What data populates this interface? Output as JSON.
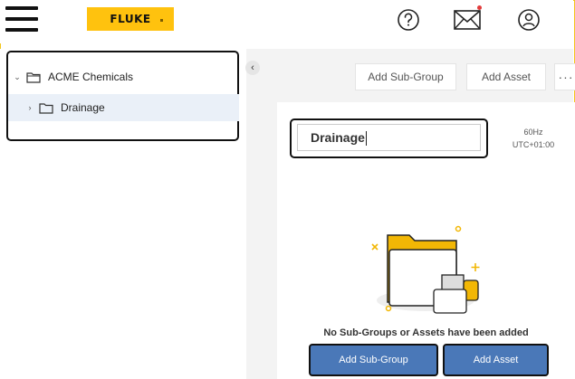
{
  "header": {
    "logo_text": "FLUKE",
    "icons": [
      "menu-icon",
      "help-icon",
      "mail-icon",
      "user-icon"
    ]
  },
  "tree": {
    "items": [
      {
        "label": "ACME Chemicals",
        "expanded": true,
        "level": 0
      },
      {
        "label": "Drainage",
        "expanded": false,
        "level": 1,
        "selected": true
      }
    ]
  },
  "toolbar": {
    "add_subgroup_label": "Add Sub-Group",
    "add_asset_label": "Add Asset",
    "more_label": "···"
  },
  "detail": {
    "name_value": "Drainage",
    "frequency": "60Hz",
    "timezone": "UTC+01:00",
    "empty_message": "No Sub-Groups or Assets have been added",
    "add_subgroup_button": "Add Sub-Group",
    "add_asset_button": "Add Asset"
  },
  "colors": {
    "brand": "#ffc20e",
    "primary_button": "#4a78b8",
    "selected_row": "#eaf0f8"
  }
}
